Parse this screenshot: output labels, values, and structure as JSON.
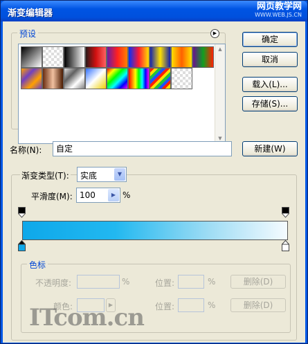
{
  "window": {
    "title": "渐变编辑器",
    "watermark_line1": "网页教学网",
    "watermark_line2": "WWW.WEB.JS.CN"
  },
  "presets": {
    "label": "预设",
    "menu_icon": "menu-arrow-icon",
    "swatches": [
      "linear-gradient(135deg,#000,#fff)",
      "repeating-conic-gradient(#ddd 0 25%,#fff 0 50%) 0 0/8px 8px",
      "linear-gradient(to right,#000,#fff)",
      "linear-gradient(to right,#2a1a1a,#d01010,#ff6060)",
      "linear-gradient(to right,#6a1ba6,#ff2020,#ff8000)",
      "linear-gradient(to right,#0030ff,#ff1a30,#ffe000)",
      "linear-gradient(to right,#1020b0,#ffe000,#1020b0)",
      "linear-gradient(to right,#ffe000,#ff6000,#ffe000)",
      "linear-gradient(to right,#6a1090,#10a020,#ff2000)",
      "linear-gradient(135deg,#ffa000,#7040c0,#ffa000,#7040c0)",
      "linear-gradient(to right,#6a2c10,#f0c0a0,#4a1a00)",
      "linear-gradient(135deg,#e0e0e0,#606060,#fff,#808080)",
      "linear-gradient(135deg,#3070ff,#fff,#f0d000)",
      "linear-gradient(135deg,#ff0000,#ffff00,#00ff00,#00ffff,#0000ff,#ff00ff)",
      "linear-gradient(to right,#ff0000,#ff8000,#ffff00,#00ff00,#00ffff,#0000ff,#ff00ff)",
      "repeating-linear-gradient(135deg,#ff2000 0 4px,#ffe000 4px 8px,#20c040 8px 12px,#2050ff 12px 16px)",
      "repeating-conic-gradient(#ddd 0 25%,#fff 0 50%) 0 0/8px 8px"
    ]
  },
  "buttons": {
    "ok": "确定",
    "cancel": "取消",
    "load": "载入(L)...",
    "save": "存储(S)...",
    "new": "新建(W)"
  },
  "name": {
    "label": "名称(N):",
    "value": "自定"
  },
  "gradient_type": {
    "label": "渐变类型(T):",
    "value": "实底"
  },
  "smoothness": {
    "label": "平滑度(M):",
    "value": "100",
    "unit": "%"
  },
  "gradient_bar": {
    "start_color": "#0ea8ea",
    "end_color": "#f5fbff"
  },
  "color_stops": {
    "label": "色标",
    "opacity_label": "不透明度:",
    "opacity_unit": "%",
    "color_label": "颜色:",
    "location_label": "位置:",
    "location_unit": "%",
    "delete_label": "删除(D)"
  },
  "watermark": "ITcom.cn"
}
